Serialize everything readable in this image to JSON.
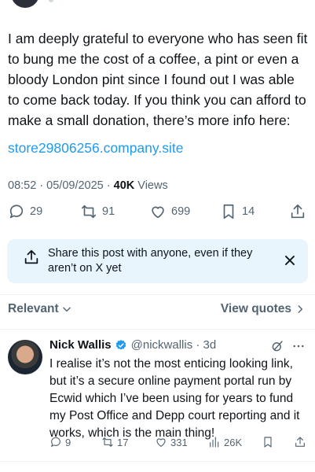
{
  "post": {
    "text": "I am deeply grateful to everyone who has seen fit to bung me the cost of a coffee, a pint or even a bloody London pint since I found out I was able to come back today. If you think you can afford to make a small donation, there’s more info here:",
    "link": "store29806256.company.site",
    "time_date": "08:52 · 05/09/2025 · ",
    "views_count": "40K",
    "views_label": " Views",
    "stats": {
      "replies": "29",
      "reposts": "91",
      "likes": "699",
      "bookmarks": "14"
    }
  },
  "share_banner": {
    "text": "Share this post with anyone, even if they aren’t on X yet"
  },
  "replies_header": {
    "sort_label": "Relevant",
    "quotes_label": "View quotes"
  },
  "reply": {
    "name": "Nick Wallis",
    "handle": "@nickwallis · 3d",
    "text": "I realise it’s not the most enticing looking link, but it’s a secure online payment portal run by Ecwid which I’ve been using for years to fund my Post Office and Depp court reporting and it works, which is the main thing!",
    "stats": {
      "replies": "9",
      "reposts": "17",
      "likes": "331",
      "views": "26K"
    }
  },
  "colors": {
    "accent": "#1d9bf0",
    "secondary_text": "#536471",
    "banner_bg": "#e8f5fd"
  }
}
